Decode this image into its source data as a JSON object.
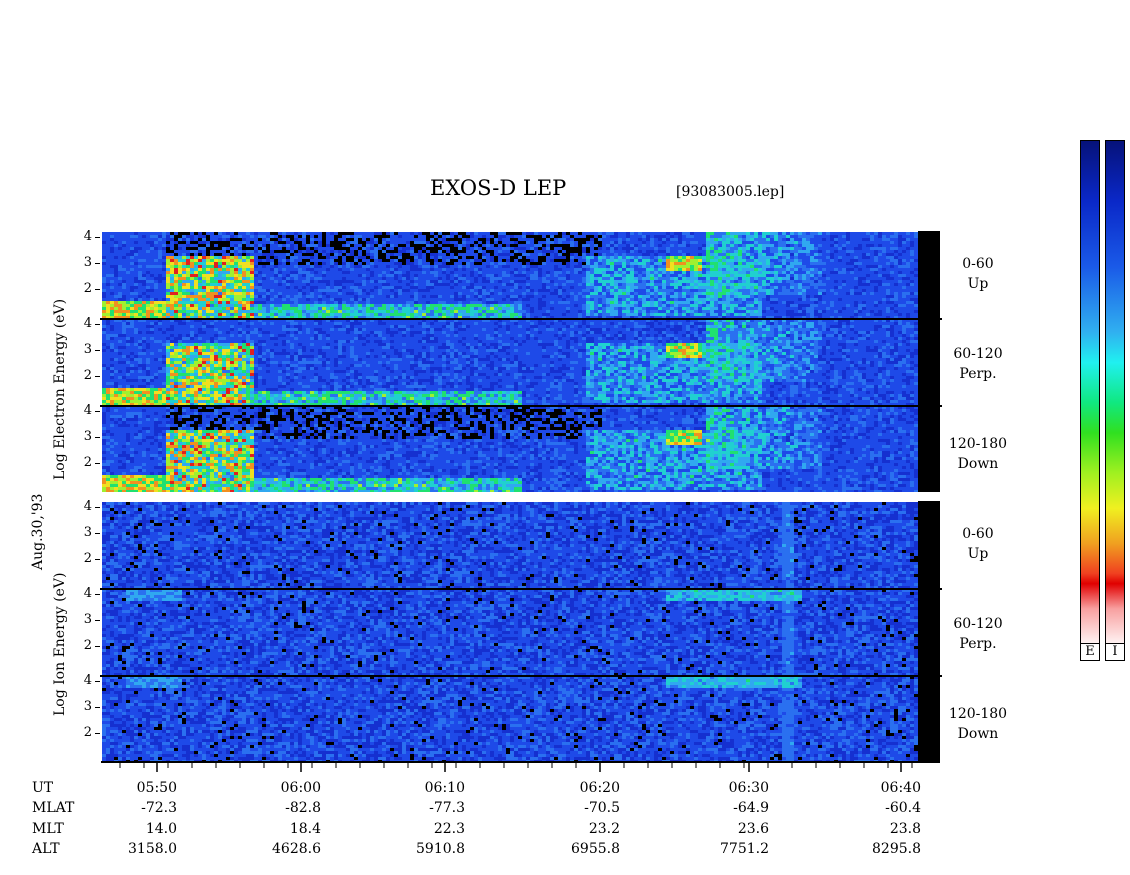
{
  "header": {
    "title": "EXOS-D LEP",
    "file": "[93083005.lep]"
  },
  "y_axis": {
    "electron_label": "Log  Electron  Energy (eV)",
    "ion_label": "Log  Ion  Energy (eV)",
    "date_label": "Aug.30,'93",
    "ticks": [
      "4",
      "3",
      "2"
    ]
  },
  "panels": [
    {
      "range": "0-60",
      "dir": "Up"
    },
    {
      "range": "60-120",
      "dir": "Perp."
    },
    {
      "range": "120-180",
      "dir": "Down"
    },
    {
      "range": "0-60",
      "dir": "Up"
    },
    {
      "range": "60-120",
      "dir": "Perp."
    },
    {
      "range": "120-180",
      "dir": "Down"
    }
  ],
  "colorbar": {
    "labels": [
      "E",
      "I"
    ]
  },
  "chart_data": {
    "type": "heatmap",
    "title": "EXOS-D LEP",
    "ylim": [
      1,
      4
    ],
    "x_axis_rows": [
      {
        "label": "UT",
        "values": [
          "05:50",
          "06:00",
          "06:10",
          "06:20",
          "06:30",
          "06:40"
        ]
      },
      {
        "label": "MLAT",
        "values": [
          "-72.3",
          "-82.8",
          "-77.3",
          "-70.5",
          "-64.9",
          "-60.4"
        ]
      },
      {
        "label": "MLT",
        "values": [
          "14.0",
          "18.4",
          "22.3",
          "23.2",
          "23.6",
          "23.8"
        ]
      },
      {
        "label": "ALT",
        "values": [
          "3158.0",
          "4628.6",
          "5910.8",
          "6955.8",
          "7751.2",
          "8295.8"
        ]
      }
    ]
  }
}
